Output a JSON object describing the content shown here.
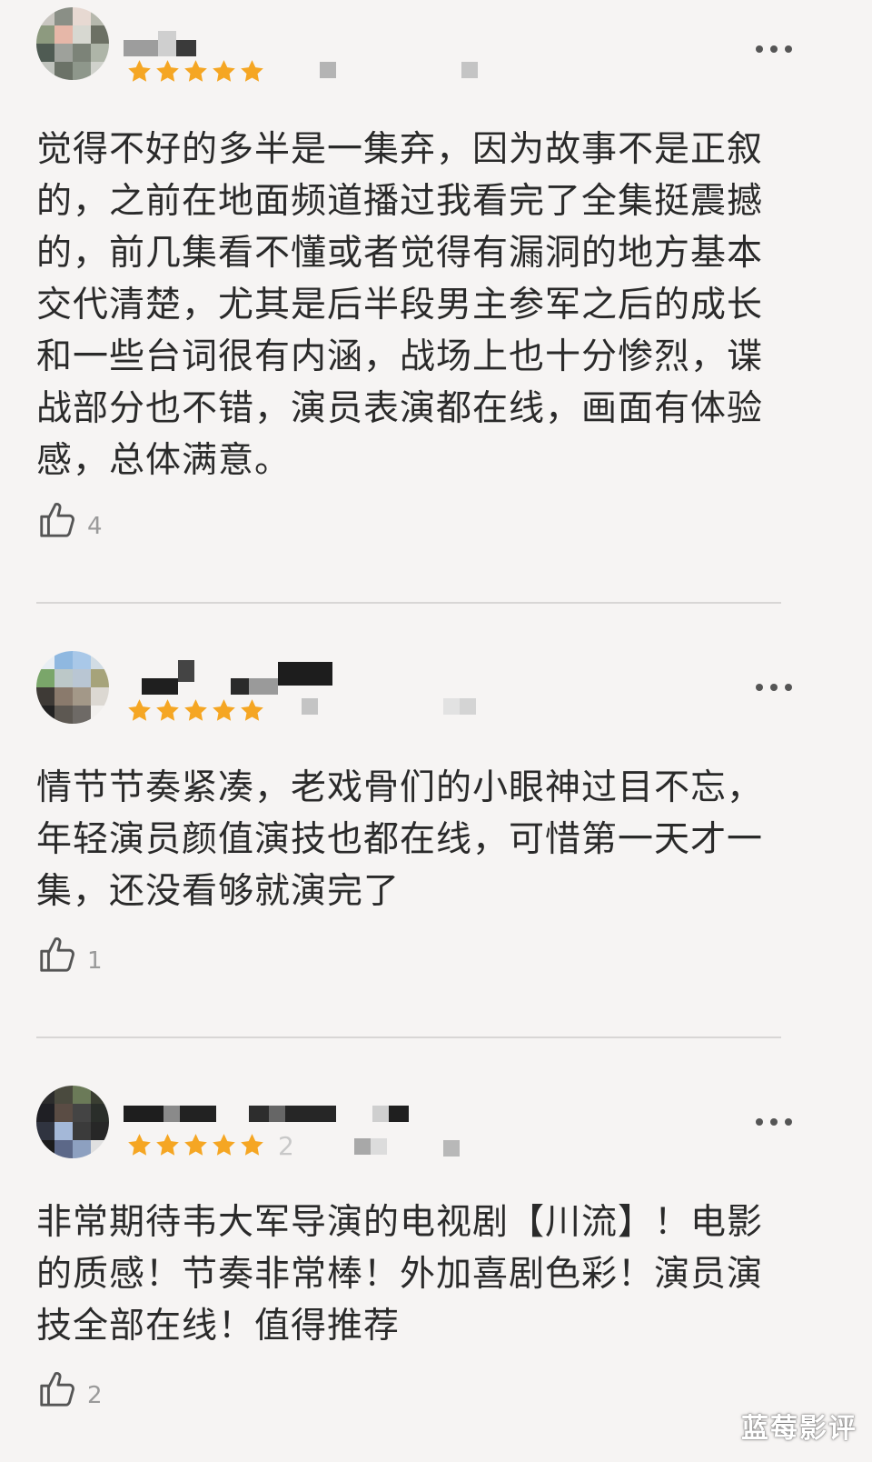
{
  "comments": [
    {
      "rating": 5,
      "text": "觉得不好的多半是一集弃，因为故事不是正叙的，之前在地面频道播过我看完了全集挺震撼的，前几集看不懂或者觉得有漏洞的地方基本交代清楚，尤其是后半段男主参军之后的成长和一些台词很有内涵，战场上也十分惨烈，谍战部分也不错，演员表演都在线，画面有体验感，总体满意。",
      "likes": "4"
    },
    {
      "rating": 5,
      "text": "情节节奏紧凑，老戏骨们的小眼神过目不忘，年轻演员颜值演技也都在线，可惜第一天才一集，还没看够就演完了",
      "likes": "1"
    },
    {
      "rating": 5,
      "partial_meta": "2",
      "text": "非常期待韦大军导演的电视剧【川流】！电影的质感！节奏非常棒！外加喜剧色彩！演员演技全部在线！值得推荐",
      "likes": "2"
    }
  ],
  "icons": {
    "like": "thumbs-up-icon",
    "more": "more-options-icon",
    "star": "star-icon"
  },
  "colors": {
    "background": "#f6f4f3",
    "star": "#f5a623",
    "text": "#2a2a2a",
    "muted": "#9a9a9a"
  },
  "watermark": "蓝莓影评"
}
